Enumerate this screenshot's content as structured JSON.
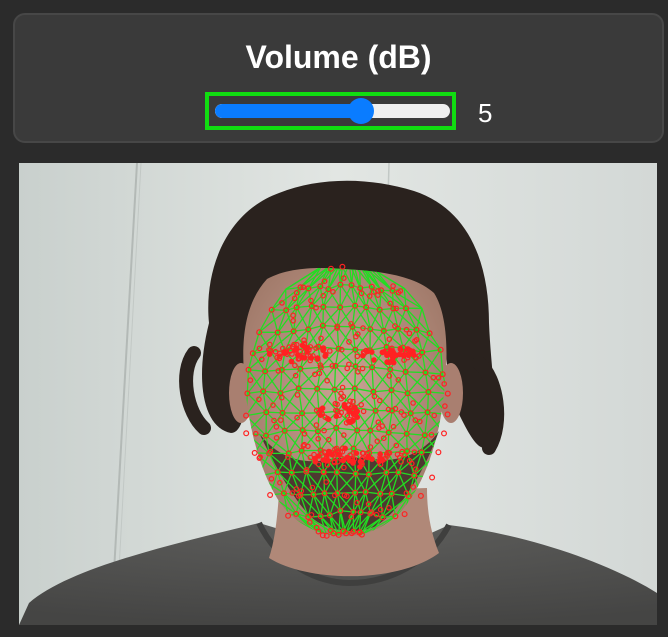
{
  "control_panel": {
    "title": "Volume (dB)",
    "slider": {
      "value": "5",
      "fill_fraction": 0.62,
      "accent_color": "#0a7cff",
      "highlight_color": "#11dd11"
    }
  },
  "camera_view": {
    "overlay": {
      "mesh_line_color": "#22dd22",
      "landmark_color": "#ff2222"
    }
  }
}
